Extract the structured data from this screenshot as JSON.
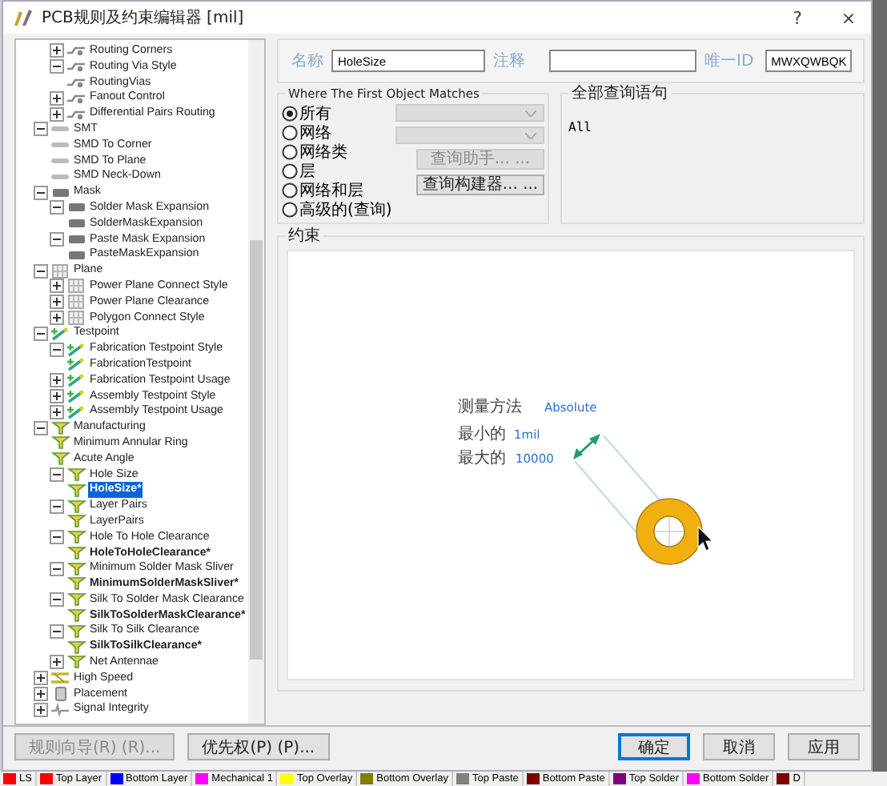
{
  "window": {
    "title": "PCB规则及约束编辑器 [mil]",
    "help": "?",
    "close": "×"
  },
  "tree": [
    {
      "children": [
        {
          "label": "Routing Corners",
          "kind": "route",
          "expanded": false,
          "selected": false
        },
        {
          "label": "Routing Via Style",
          "kind": "route",
          "expanded": true,
          "selected": false,
          "children": [
            {
              "label": "RoutingVias",
              "kind": "route",
              "selected": false,
              "modified": false
            }
          ]
        },
        {
          "label": "Fanout Control",
          "kind": "route",
          "expanded": false,
          "selected": false
        },
        {
          "label": "Differential Pairs Routing",
          "kind": "route",
          "expanded": false,
          "selected": false
        }
      ]
    },
    {
      "label": "SMT",
      "kind": "smt",
      "expanded": true,
      "selected": false,
      "children": [
        {
          "label": "SMD To Corner",
          "kind": "smt",
          "selected": false
        },
        {
          "label": "SMD To Plane",
          "kind": "smt",
          "selected": false
        },
        {
          "label": "SMD Neck-Down",
          "kind": "smt",
          "selected": false
        }
      ]
    },
    {
      "label": "Mask",
      "kind": "mask",
      "expanded": true,
      "selected": false,
      "children": [
        {
          "label": "Solder Mask Expansion",
          "kind": "mask",
          "expanded": true,
          "selected": false,
          "children": [
            {
              "label": "SolderMaskExpansion",
              "kind": "mask",
              "selected": false,
              "modified": false
            }
          ]
        },
        {
          "label": "Paste Mask Expansion",
          "kind": "mask",
          "expanded": true,
          "selected": false,
          "children": [
            {
              "label": "PasteMaskExpansion",
              "kind": "mask",
              "selected": false,
              "modified": false
            }
          ]
        }
      ]
    },
    {
      "label": "Plane",
      "kind": "plane",
      "expanded": true,
      "selected": false,
      "children": [
        {
          "label": "Power Plane Connect Style",
          "kind": "plane",
          "expanded": false,
          "selected": false
        },
        {
          "label": "Power Plane Clearance",
          "kind": "plane",
          "expanded": false,
          "selected": false
        },
        {
          "label": "Polygon Connect Style",
          "kind": "plane",
          "expanded": false,
          "selected": false
        }
      ]
    },
    {
      "label": "Testpoint",
      "kind": "testpoint",
      "expanded": true,
      "selected": false,
      "children": [
        {
          "label": "Fabrication Testpoint Style",
          "kind": "testpoint",
          "expanded": true,
          "selected": false,
          "children": [
            {
              "label": "FabricationTestpoint",
              "kind": "testpoint",
              "selected": false,
              "modified": false
            }
          ]
        },
        {
          "label": "Fabrication Testpoint Usage",
          "kind": "testpoint",
          "expanded": false,
          "selected": false
        },
        {
          "label": "Assembly Testpoint Style",
          "kind": "testpoint",
          "expanded": false,
          "selected": false
        },
        {
          "label": "Assembly Testpoint Usage",
          "kind": "testpoint",
          "expanded": false,
          "selected": false
        }
      ]
    },
    {
      "label": "Manufacturing",
      "kind": "mfg",
      "expanded": true,
      "selected": false,
      "children": [
        {
          "label": "Minimum Annular Ring",
          "kind": "mfg",
          "selected": false
        },
        {
          "label": "Acute Angle",
          "kind": "mfg",
          "selected": false
        },
        {
          "label": "Hole Size",
          "kind": "mfg",
          "expanded": true,
          "selected": false,
          "children": [
            {
              "label": "HoleSize*",
              "kind": "mfg",
              "selected": true,
              "modified": true
            }
          ]
        },
        {
          "label": "Layer Pairs",
          "kind": "mfg",
          "expanded": true,
          "selected": false,
          "children": [
            {
              "label": "LayerPairs",
              "kind": "mfg",
              "selected": false,
              "modified": false
            }
          ]
        },
        {
          "label": "Hole To Hole Clearance",
          "kind": "mfg",
          "expanded": true,
          "selected": false,
          "children": [
            {
              "label": "HoleToHoleClearance*",
              "kind": "mfg",
              "selected": false,
              "modified": true
            }
          ]
        },
        {
          "label": "Minimum Solder Mask Sliver",
          "kind": "mfg",
          "expanded": true,
          "selected": false,
          "children": [
            {
              "label": "MinimumSolderMaskSliver*",
              "kind": "mfg",
              "selected": false,
              "modified": true
            }
          ]
        },
        {
          "label": "Silk To Solder Mask Clearance",
          "kind": "mfg",
          "expanded": true,
          "selected": false,
          "children": [
            {
              "label": "SilkToSolderMaskClearance*",
              "kind": "mfg",
              "selected": false,
              "modified": true
            }
          ]
        },
        {
          "label": "Silk To Silk Clearance",
          "kind": "mfg",
          "expanded": true,
          "selected": false,
          "children": [
            {
              "label": "SilkToSilkClearance*",
              "kind": "mfg",
              "selected": false,
              "modified": true
            }
          ]
        },
        {
          "label": "Net Antennae",
          "kind": "mfg",
          "expanded": false,
          "selected": false
        }
      ]
    },
    {
      "label": "High Speed",
      "kind": "highspeed",
      "expanded": false,
      "selected": false
    },
    {
      "label": "Placement",
      "kind": "placement",
      "expanded": false,
      "selected": false
    },
    {
      "label": "Signal Integrity",
      "kind": "signal",
      "expanded": false,
      "selected": false
    }
  ],
  "rule": {
    "name_label": "名称",
    "name": "HoleSize",
    "comment_label": "注释",
    "id_label": "唯一ID",
    "id": "MWXQWBQK"
  },
  "where": {
    "title": "Where The First Object Matches",
    "options": [
      {
        "label": "所有",
        "selected": true
      },
      {
        "label": "网络",
        "selected": false
      },
      {
        "label": "网络类",
        "selected": false
      },
      {
        "label": "层",
        "selected": false
      },
      {
        "label": "网络和层",
        "selected": false
      },
      {
        "label": "高级的(查询)",
        "selected": false
      }
    ],
    "helper_button": {
      "label": "查询助手... ...",
      "disabled": true
    },
    "builder_button": {
      "label": "查询构建器... ...",
      "disabled": false
    }
  },
  "query": {
    "title": "全部查询语句",
    "text": "All"
  },
  "constraint": {
    "title": "约束",
    "method_label": "测量方法",
    "method": "Absolute",
    "min_label": "最小的",
    "min": "1mil",
    "max_label": "最大的",
    "max": "10000"
  },
  "buttons_left": [
    {
      "label": "规则向导(R) (R)...",
      "disabled": true
    },
    {
      "label": "优先权(P) (P)...",
      "disabled": false
    }
  ],
  "buttons_right": [
    {
      "label": "确定",
      "default": true
    },
    {
      "label": "取消",
      "default": false
    },
    {
      "label": "应用",
      "default": false
    }
  ],
  "layers": [
    {
      "label": "LS",
      "color": "#ff0000"
    },
    {
      "label": "Top Layer",
      "color": "#ff0000"
    },
    {
      "label": "Bottom Layer",
      "color": "#0000ff"
    },
    {
      "label": "Mechanical 1",
      "color": "#ff00ff"
    },
    {
      "label": "Top Overlay",
      "color": "#ffff00"
    },
    {
      "label": "Bottom Overlay",
      "color": "#808000"
    },
    {
      "label": "Top Paste",
      "color": "#808080"
    },
    {
      "label": "Bottom Paste",
      "color": "#800000"
    },
    {
      "label": "Top Solder",
      "color": "#800080"
    },
    {
      "label": "Bottom Solder",
      "color": "#ff00ff"
    },
    {
      "label": "D",
      "color": "#800000"
    }
  ]
}
